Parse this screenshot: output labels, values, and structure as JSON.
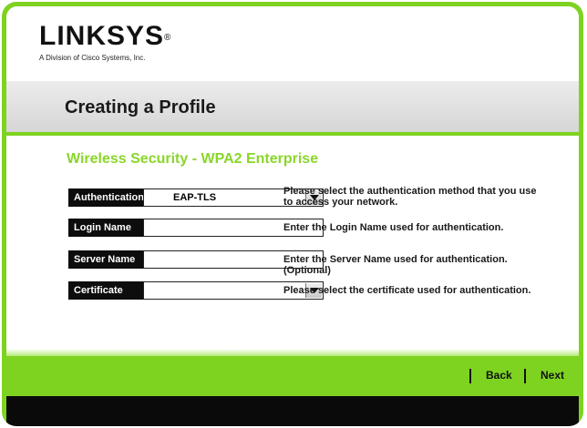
{
  "brand": {
    "name": "LINKSYS",
    "registered": "®",
    "subtitle": "A Division of Cisco Systems, Inc."
  },
  "page": {
    "title": "Creating a Profile"
  },
  "section": {
    "title": "Wireless Security - WPA2 Enterprise"
  },
  "fields": {
    "authentication": {
      "label": "Authentication",
      "value": "EAP-TLS",
      "help_line1": "Please select the authentication method that you use",
      "help_line2": "to access your network."
    },
    "login_name": {
      "label": "Login Name",
      "value": "",
      "help": "Enter the Login Name used for authentication."
    },
    "server_name": {
      "label": "Server Name",
      "value": "",
      "help": "Enter the Server Name used for authentication.",
      "help_optional": "(Optional)"
    },
    "certificate": {
      "label": "Certificate",
      "value": "",
      "help": "Please select the certificate used for authentication."
    }
  },
  "nav": {
    "back": "Back",
    "next": "Next"
  },
  "colors": {
    "accent": "#7ed321",
    "dark": "#0d0d0d"
  }
}
